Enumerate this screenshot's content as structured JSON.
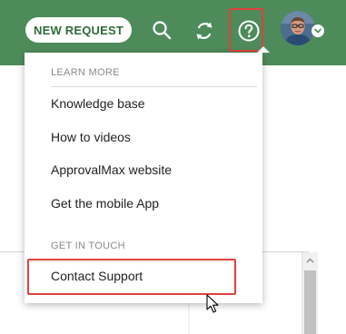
{
  "header": {
    "new_request_label": "NEW REQUEST",
    "icons": {
      "search": "search-icon",
      "sync": "sync-icon",
      "help": "help-icon",
      "avatar": "user-avatar",
      "chevron": "chevron-down-icon"
    }
  },
  "help_menu": {
    "sections": [
      {
        "header": "LEARN MORE",
        "items": [
          "Knowledge base",
          "How to videos",
          "ApprovalMax website",
          "Get the mobile App"
        ]
      },
      {
        "header": "GET IN TOUCH",
        "items": [
          "Contact Support"
        ]
      }
    ]
  },
  "colors": {
    "header_bg": "#4e8b5b",
    "button_text": "#2f6b3b",
    "highlight": "#e0413c",
    "menu_text": "#222222",
    "section_header_text": "#8a8a8a"
  }
}
